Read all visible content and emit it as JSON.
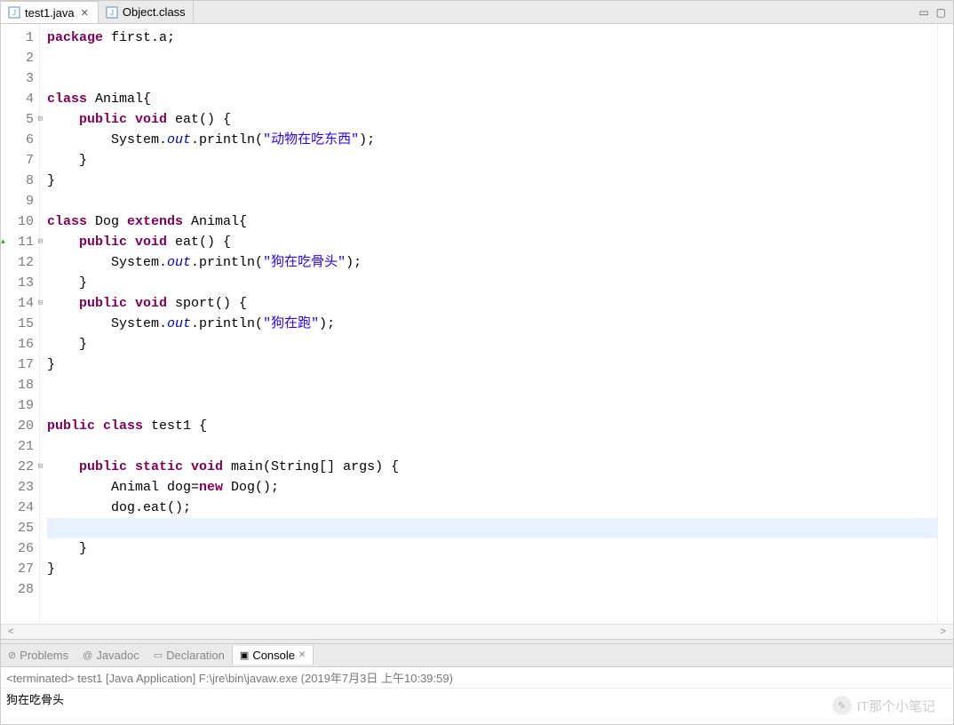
{
  "tabs": [
    {
      "label": "test1.java",
      "active": true,
      "closable": true
    },
    {
      "label": "Object.class",
      "active": false,
      "closable": false
    }
  ],
  "gutter": {
    "lines": [
      {
        "n": "1"
      },
      {
        "n": "2"
      },
      {
        "n": "3"
      },
      {
        "n": "4"
      },
      {
        "n": "5",
        "fold": true
      },
      {
        "n": "6"
      },
      {
        "n": "7"
      },
      {
        "n": "8"
      },
      {
        "n": "9"
      },
      {
        "n": "10"
      },
      {
        "n": "11",
        "fold": true,
        "override": true
      },
      {
        "n": "12"
      },
      {
        "n": "13"
      },
      {
        "n": "14",
        "fold": true
      },
      {
        "n": "15"
      },
      {
        "n": "16"
      },
      {
        "n": "17"
      },
      {
        "n": "18"
      },
      {
        "n": "19"
      },
      {
        "n": "20"
      },
      {
        "n": "21"
      },
      {
        "n": "22",
        "fold": true
      },
      {
        "n": "23"
      },
      {
        "n": "24"
      },
      {
        "n": "25"
      },
      {
        "n": "26"
      },
      {
        "n": "27"
      },
      {
        "n": "28"
      }
    ]
  },
  "code": {
    "lines": [
      {
        "tokens": [
          {
            "t": "package ",
            "c": "kw"
          },
          {
            "t": "first.a;"
          }
        ]
      },
      {
        "tokens": []
      },
      {
        "tokens": []
      },
      {
        "tokens": [
          {
            "t": "class ",
            "c": "kw"
          },
          {
            "t": "Animal{"
          }
        ]
      },
      {
        "tokens": [
          {
            "t": "    "
          },
          {
            "t": "public void ",
            "c": "kw"
          },
          {
            "t": "eat() {"
          }
        ]
      },
      {
        "tokens": [
          {
            "t": "        System."
          },
          {
            "t": "out",
            "c": "it"
          },
          {
            "t": ".println("
          },
          {
            "t": "\"动物在吃东西\"",
            "c": "str"
          },
          {
            "t": ");"
          }
        ]
      },
      {
        "tokens": [
          {
            "t": "    }"
          }
        ]
      },
      {
        "tokens": [
          {
            "t": "}"
          }
        ]
      },
      {
        "tokens": []
      },
      {
        "tokens": [
          {
            "t": "class ",
            "c": "kw"
          },
          {
            "t": "Dog "
          },
          {
            "t": "extends ",
            "c": "kw"
          },
          {
            "t": "Animal{"
          }
        ]
      },
      {
        "tokens": [
          {
            "t": "    "
          },
          {
            "t": "public void ",
            "c": "kw"
          },
          {
            "t": "eat() {"
          }
        ]
      },
      {
        "tokens": [
          {
            "t": "        System."
          },
          {
            "t": "out",
            "c": "it"
          },
          {
            "t": ".println("
          },
          {
            "t": "\"狗在吃骨头\"",
            "c": "str"
          },
          {
            "t": ");"
          }
        ]
      },
      {
        "tokens": [
          {
            "t": "    }"
          }
        ]
      },
      {
        "tokens": [
          {
            "t": "    "
          },
          {
            "t": "public void ",
            "c": "kw"
          },
          {
            "t": "sport() {"
          }
        ]
      },
      {
        "tokens": [
          {
            "t": "        System."
          },
          {
            "t": "out",
            "c": "it"
          },
          {
            "t": ".println("
          },
          {
            "t": "\"狗在跑\"",
            "c": "str"
          },
          {
            "t": ");"
          }
        ]
      },
      {
        "tokens": [
          {
            "t": "    }"
          }
        ]
      },
      {
        "tokens": [
          {
            "t": "}"
          }
        ]
      },
      {
        "tokens": []
      },
      {
        "tokens": []
      },
      {
        "tokens": [
          {
            "t": "public class ",
            "c": "kw"
          },
          {
            "t": "test1 {"
          }
        ]
      },
      {
        "tokens": []
      },
      {
        "tokens": [
          {
            "t": "    "
          },
          {
            "t": "public static void ",
            "c": "kw"
          },
          {
            "t": "main(String[] args) {"
          }
        ]
      },
      {
        "tokens": [
          {
            "t": "        Animal dog="
          },
          {
            "t": "new ",
            "c": "kw"
          },
          {
            "t": "Dog();"
          }
        ]
      },
      {
        "tokens": [
          {
            "t": "        dog.eat();"
          }
        ]
      },
      {
        "tokens": [
          {
            "t": "        "
          }
        ],
        "highlight": true
      },
      {
        "tokens": [
          {
            "t": "    }"
          }
        ]
      },
      {
        "tokens": [
          {
            "t": "}"
          }
        ]
      },
      {
        "tokens": []
      }
    ]
  },
  "bottomTabs": [
    {
      "label": "Problems",
      "icon": "⊘"
    },
    {
      "label": "Javadoc",
      "icon": "@"
    },
    {
      "label": "Declaration",
      "icon": "▭"
    },
    {
      "label": "Console",
      "icon": "▣",
      "active": true,
      "closable": true
    }
  ],
  "console": {
    "header": "<terminated> test1 [Java Application] F:\\jre\\bin\\javaw.exe (2019年7月3日 上午10:39:59)",
    "output": "狗在吃骨头"
  },
  "watermark": "IT那个小笔记"
}
